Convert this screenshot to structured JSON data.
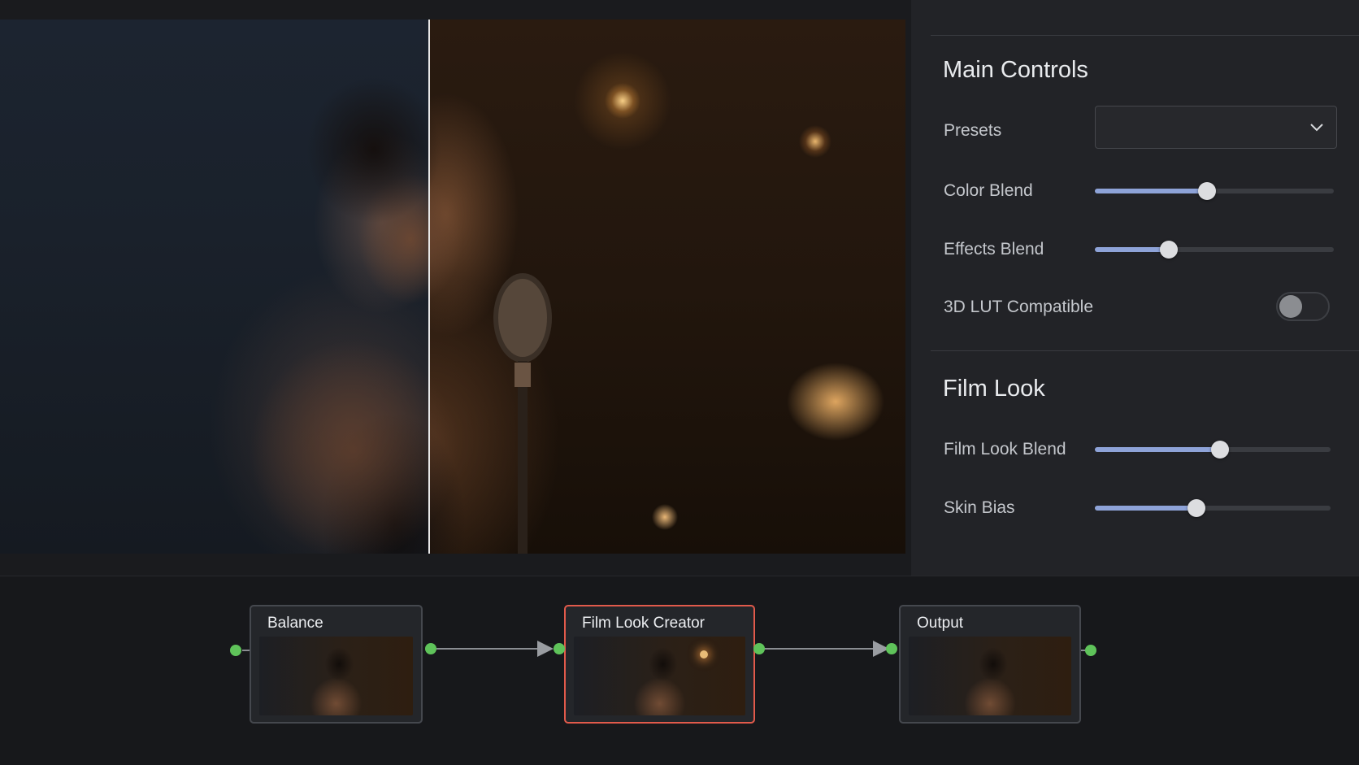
{
  "panel": {
    "main_controls_title": "Main Controls",
    "presets_label": "Presets",
    "presets_value": "",
    "color_blend_label": "Color Blend",
    "color_blend_value": 0.47,
    "effects_blend_label": "Effects Blend",
    "effects_blend_value": 0.31,
    "lut_label": "3D LUT Compatible",
    "lut_enabled": false,
    "film_look_title": "Film Look",
    "film_look_blend_label": "Film Look Blend",
    "film_look_blend_value": 0.53,
    "skin_bias_label": "Skin Bias",
    "skin_bias_value": 0.43
  },
  "nodes": [
    {
      "title": "Balance",
      "selected": false
    },
    {
      "title": "Film Look Creator",
      "selected": true
    },
    {
      "title": "Output",
      "selected": false
    }
  ],
  "colors": {
    "accent": "#8ea3d8",
    "node_selected_border": "#e15a4b",
    "port": "#5fc35a"
  },
  "icons": [
    "chevron-down-icon",
    "connection-arrow-icon"
  ]
}
